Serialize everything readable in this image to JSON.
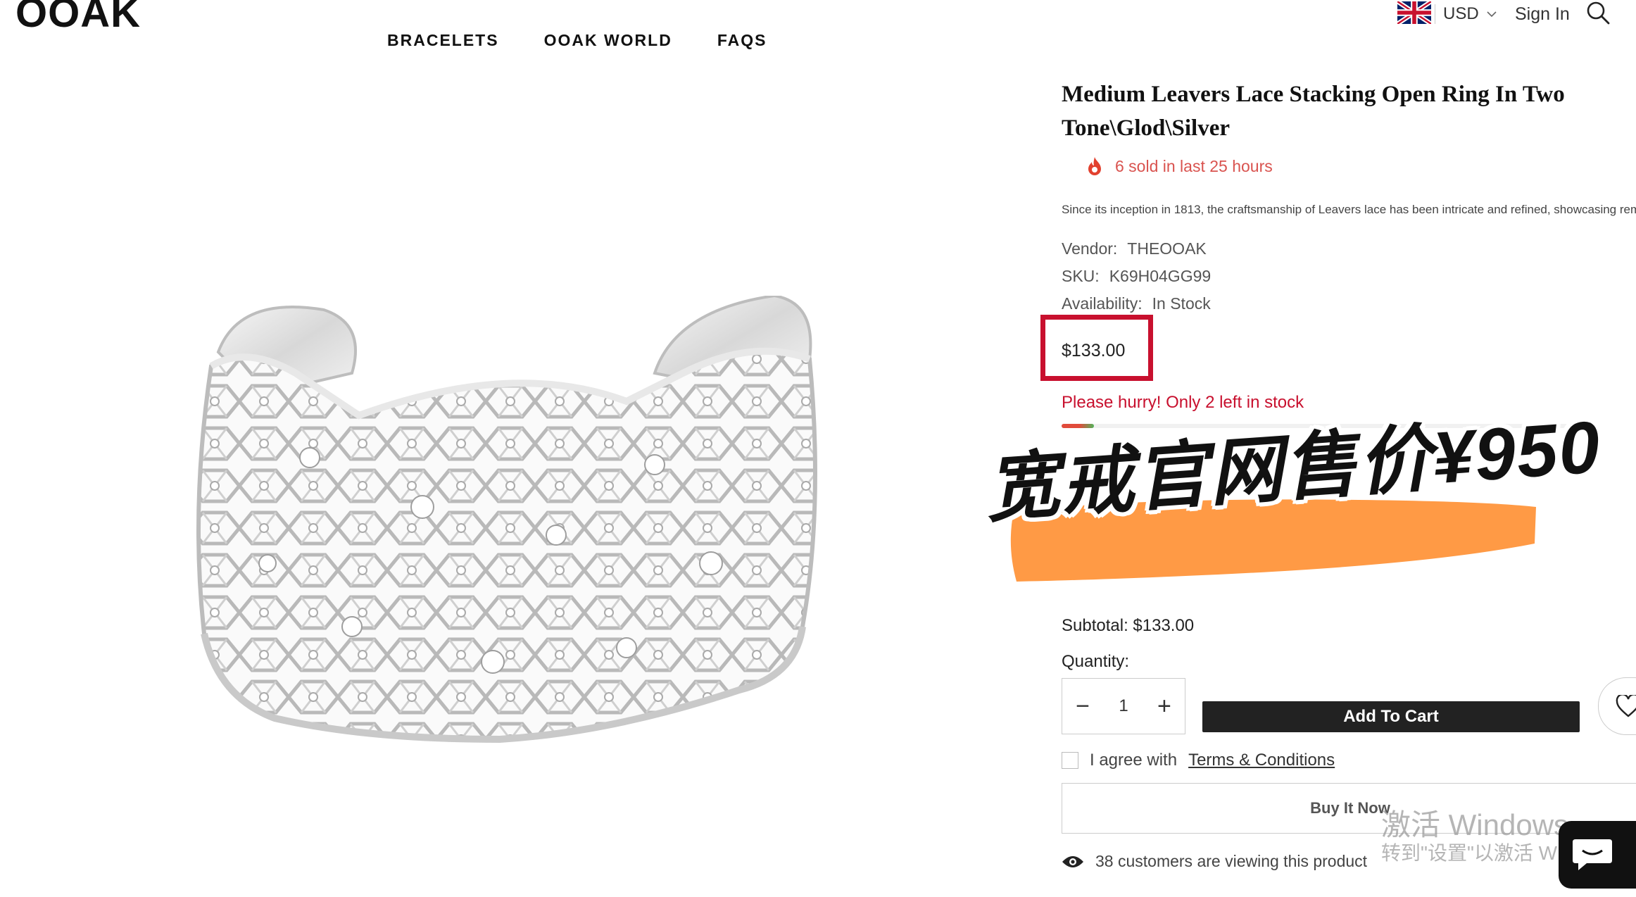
{
  "brand": {
    "logo": "OOAK"
  },
  "nav": {
    "items": [
      {
        "label": "BRACELETS"
      },
      {
        "label": "OOAK WORLD"
      },
      {
        "label": "FAQS"
      }
    ]
  },
  "header": {
    "currency": "USD",
    "sign_in": "Sign In"
  },
  "product": {
    "title": "Medium Leavers Lace Stacking Open Ring In Two Tone\\Glod\\Silver",
    "sold": "6 sold in last 25 hours",
    "description": "Since its inception in 1813, the craftsmanship of Leavers lace has been intricate and refined, showcasing rem",
    "vendor_label": "Vendor:",
    "vendor": "THEOOAK",
    "sku_label": "SKU:",
    "sku": "K69H04GG99",
    "availability_label": "Availability:",
    "availability": "In Stock",
    "price": "$133.00",
    "hurry": "Please hurry! Only 2 left in stock",
    "stock_fraction": 0.06
  },
  "overlay": {
    "promo": "宽戒官网售价¥950"
  },
  "purchase": {
    "subtotal": "Subtotal: $133.00",
    "quantity_label": "Quantity:",
    "quantity": "1",
    "add_to_cart": "Add To Cart",
    "agree_text": "I agree with",
    "terms_link": "Terms & Conditions",
    "buy_now": "Buy It Now",
    "viewing": "38 customers are viewing this product"
  },
  "watermark": {
    "line1": "激活 Windows",
    "line2": "转到\"设置\"以激活 Windows"
  },
  "colors": {
    "accent_red": "#c8102e",
    "hurry_red": "#d9534f",
    "brush_orange": "#ff9a45",
    "button_dark": "#222222"
  },
  "icons": [
    "uk-flag-icon",
    "chevron-down-icon",
    "search-icon",
    "fire-icon",
    "minus-icon",
    "plus-icon",
    "heart-icon",
    "eye-icon",
    "chat-icon"
  ]
}
